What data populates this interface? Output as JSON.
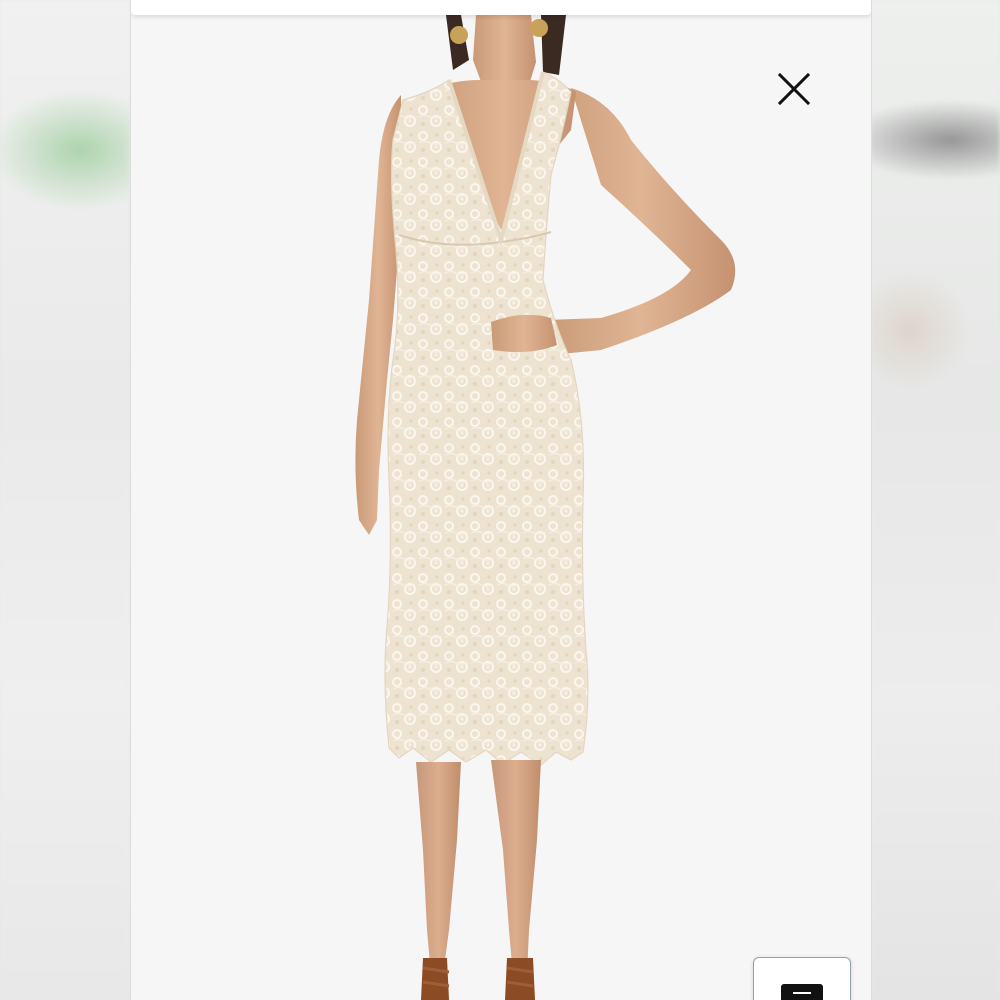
{
  "viewer": {
    "image_subject": "model-wearing-cream-lace-halter-midi-dress",
    "background_color": "#f6f6f6",
    "dress_color": "#efe6d6"
  },
  "controls": {
    "close_icon": "close-icon",
    "chat_icon": "chat-icon"
  }
}
